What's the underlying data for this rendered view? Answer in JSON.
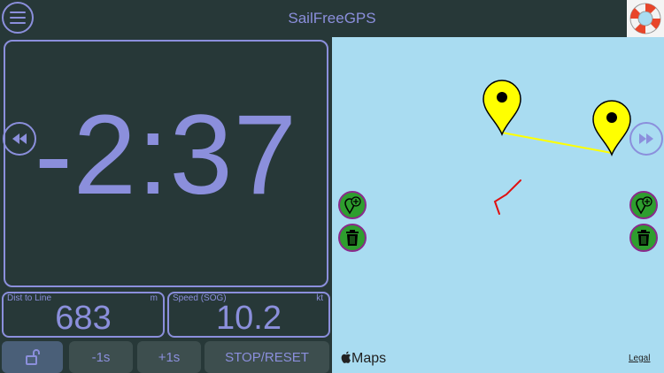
{
  "app": {
    "title": "SailFreeGPS"
  },
  "timer": {
    "display": "-2:37"
  },
  "stats": {
    "dist": {
      "label": "Dist to Line",
      "unit": "m",
      "value": "683"
    },
    "speed": {
      "label": "Speed (SOG)",
      "unit": "kt",
      "value": "10.2"
    }
  },
  "buttons": {
    "minus": "-1s",
    "plus": "+1s",
    "stop_reset": "STOP/RESET"
  },
  "map": {
    "provider": "Maps",
    "legal": "Legal"
  },
  "colors": {
    "accent": "#8b8fdc",
    "background": "#273838",
    "map_water": "#a9dcf1",
    "pin": "#ffff00",
    "track": "#e01010",
    "map_button": "#2e9e2e"
  },
  "icons": [
    "menu-icon",
    "lifebuoy-icon",
    "rewind-icon",
    "fast-forward-icon",
    "lock-open-icon",
    "add-pin-icon",
    "trash-icon",
    "apple-logo-icon",
    "map-pin-icon"
  ]
}
